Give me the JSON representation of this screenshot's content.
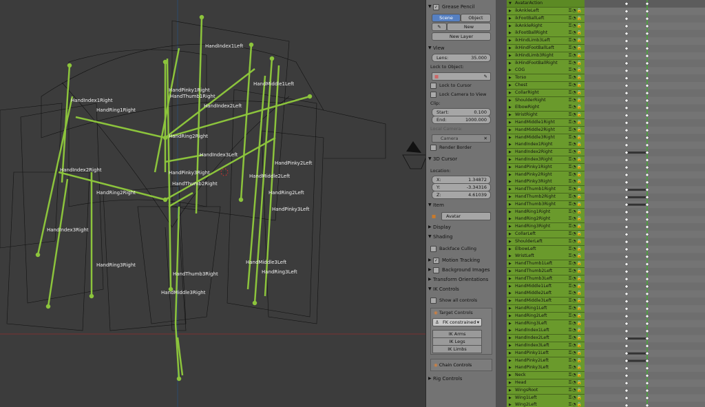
{
  "viewport": {
    "labels": [
      "HandIndex1Left",
      "HandIndex1Right",
      "HandRing1Right",
      "HandPinky1Right",
      "HandThumb1Right",
      "HandIndex2Left",
      "HandMiddle1Left",
      "HandRing2Right",
      "HandIndex3Left",
      "HandIndex2Right",
      "HandPinky3Right",
      "HandThumb2Right",
      "HandMiddle2Left",
      "HandPinky2Left",
      "HandRing2Right",
      "HandPinky3Left",
      "HandRing2Left",
      "HandIndex3Right",
      "HandRing3Right",
      "HandMiddle3Left",
      "HandRing3Left",
      "HandThumb3Right",
      "HandMiddle3Right"
    ]
  },
  "props": {
    "grease_pencil": "Grease Pencil",
    "scene_tab": "Scene",
    "object_tab": "Object",
    "new_btn": "New",
    "new_layer_btn": "New Layer",
    "view_header": "View",
    "lens_label": "Lens:",
    "lens_value": "35.000",
    "lock_to_object": "Lock to Object:",
    "lock_to_cursor": "Lock to Cursor",
    "lock_camera": "Lock Camera to View",
    "clip_label": "Clip:",
    "clip_start_label": "Start:",
    "clip_start_value": "0.100",
    "clip_end_label": "End:",
    "clip_end_value": "1000.000",
    "local_camera": "Local Camera:",
    "camera": "Camera",
    "render_border": "Render Border",
    "cursor_header": "3D Cursor",
    "location_label": "Location:",
    "x_label": "X:",
    "x_value": "1.34872",
    "y_label": "Y:",
    "y_value": "-3.34316",
    "z_label": "Z:",
    "z_value": "4.61039",
    "item_header": "Item",
    "item_name": "Avatar",
    "display_header": "Display",
    "shading_header": "Shading",
    "backface": "Backface Culling",
    "motion_tracking": "Motion Tracking",
    "background_images": "Background Images",
    "transform_orientations": "Transform Orientations",
    "ik_controls": "IK Controls",
    "show_all_controls": "Show all controls",
    "target_controls": "Target Controls",
    "fk_constrained": "FK constrained",
    "ik_arms": "IK Arms",
    "ik_legs": "IK Legs",
    "ik_limbs": "IK Limbs",
    "chain_controls": "Chain Controls",
    "rig_controls": "Rig Controls"
  },
  "channels": {
    "header": "AvatarAction",
    "items": [
      "ikAnkleLeft",
      "ikFootBallLeft",
      "ikAnkleRight",
      "ikFootBallRight",
      "ikHindLimb3Left",
      "ikHindFootBallLeft",
      "ikHindLimb3Right",
      "ikHindFootBallRight",
      "COG",
      "Torso",
      "Chest",
      "CollarRight",
      "ShoulderRight",
      "ElbowRight",
      "WristRight",
      "HandMiddle1Right",
      "HandMiddle2Right",
      "HandMiddle3Right",
      "HandIndex1Right",
      "HandIndex2Right",
      "HandIndex3Right",
      "HandPinky1Right",
      "HandPinky2Right",
      "HandPinky3Right",
      "HandThumb1Right",
      "HandThumb2Right",
      "HandThumb3Right",
      "HandRing1Right",
      "HandRing2Right",
      "HandRing3Right",
      "CollarLeft",
      "ShoulderLeft",
      "ElbowLeft",
      "WristLeft",
      "HandThumb1Left",
      "HandThumb2Left",
      "HandThumb3Left",
      "HandMiddle1Left",
      "HandMiddle2Left",
      "HandMiddle3Left",
      "HandRing1Left",
      "HandRing2Left",
      "HandRing3Left",
      "HandIndex1Left",
      "HandIndex2Left",
      "HandIndex3Left",
      "HandPinky1Left",
      "HandPinky2Left",
      "HandPinky3Left",
      "Neck",
      "Head",
      "WingsRoot",
      "Wing1Left",
      "Wing2Left"
    ]
  },
  "colors": {
    "bone": "#8cc43c",
    "channel": "#6a9a2c",
    "playhead": "#44aa33"
  }
}
